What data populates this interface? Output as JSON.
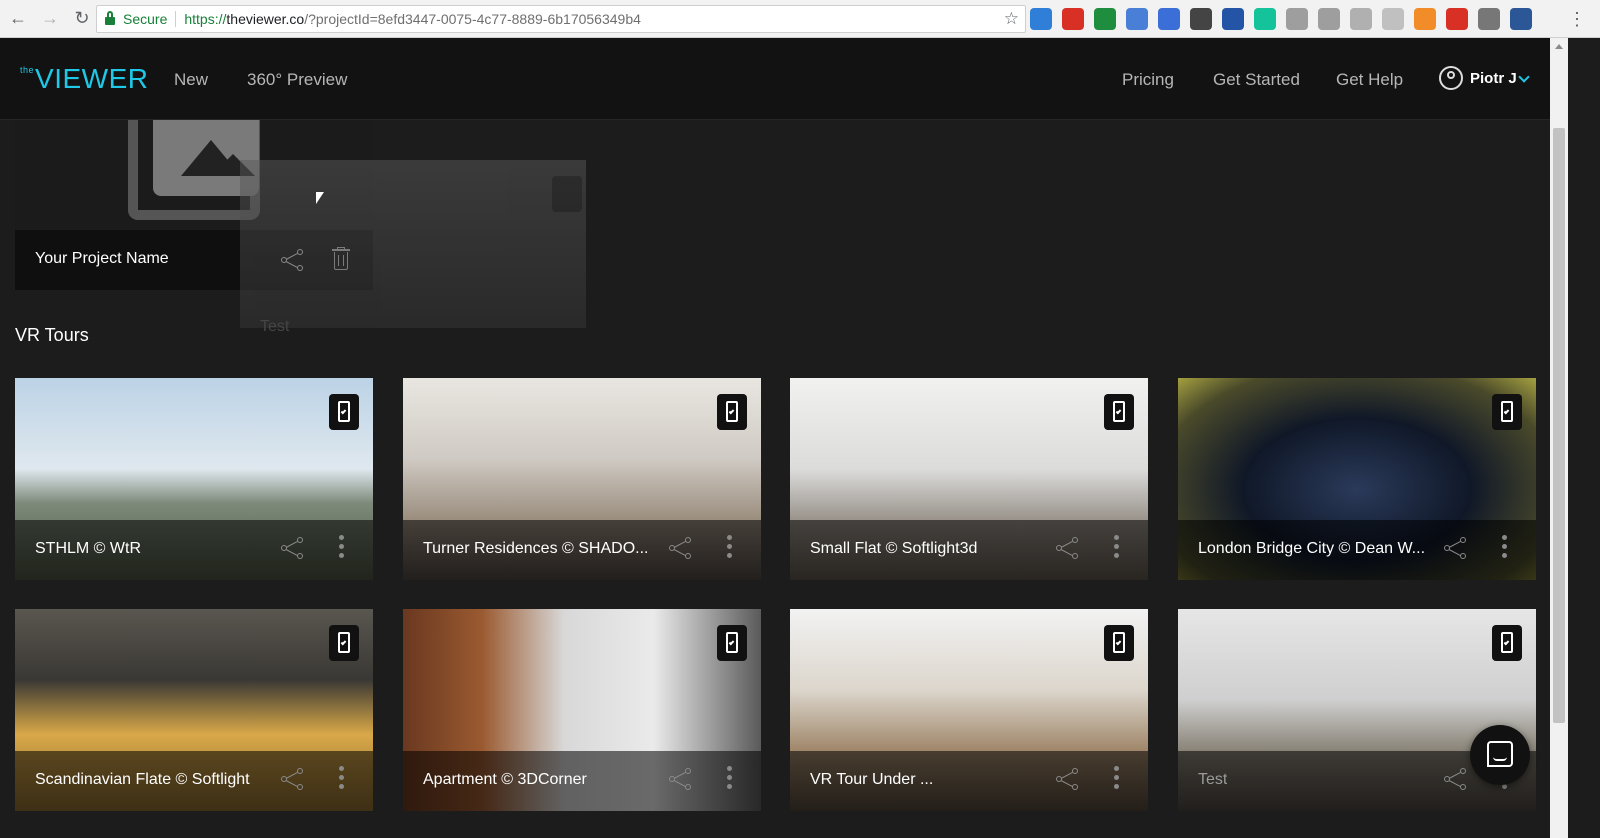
{
  "browser": {
    "secure_label": "Secure",
    "url_protocol": "https://",
    "url_host": "theviewer.co",
    "url_path": "/?projectId=8efd3447-0075-4c77-8889-6b17056349b4",
    "extensions": [
      {
        "icon": "shield-extension-icon",
        "color": "#2f7fd8"
      },
      {
        "icon": "circle-red-extension-icon",
        "color": "#d93025"
      },
      {
        "icon": "green-dot-extension-icon",
        "color": "#1e8e3e"
      },
      {
        "icon": "blue-box-extension-icon",
        "color": "#4a7fd8"
      },
      {
        "icon": "code-extension-icon",
        "color": "#3b6ed6"
      },
      {
        "icon": "pin-extension-icon",
        "color": "#444444"
      },
      {
        "icon": "new-extension-icon",
        "color": "#2454a6"
      },
      {
        "icon": "grammarly-extension-icon",
        "color": "#15c39a"
      },
      {
        "icon": "camera-extension-icon",
        "color": "#9e9e9e"
      },
      {
        "icon": "drive-extension-icon",
        "color": "#9e9e9e"
      },
      {
        "icon": "save-extension-icon",
        "color": "#b0b0b0"
      },
      {
        "icon": "grid-extension-icon",
        "color": "#c0c0c0"
      },
      {
        "icon": "off-extension-icon",
        "color": "#f28c28"
      },
      {
        "icon": "gear-red-extension-icon",
        "color": "#d93025"
      },
      {
        "icon": "window-extension-icon",
        "color": "#777777"
      },
      {
        "icon": "word-extension-icon",
        "color": "#2b5797"
      }
    ]
  },
  "header": {
    "logo_prefix": "the",
    "logo_main": "VIEWER",
    "nav_left": [
      "New",
      "360° Preview"
    ],
    "nav_right": [
      "Pricing",
      "Get Started",
      "Get Help"
    ],
    "user_name": "Piotr J",
    "accent_color": "#1ec8e6"
  },
  "draft_project": {
    "title": "Your Project Name",
    "ghost_title": "Test"
  },
  "section_title": "VR Tours",
  "tours": [
    {
      "title": "STHLM © WtR",
      "dim": false
    },
    {
      "title": "Turner Residences © SHADO...",
      "dim": false
    },
    {
      "title": "Small Flat © Softlight3d",
      "dim": false
    },
    {
      "title": "London Bridge City © Dean W...",
      "dim": false
    },
    {
      "title": "Scandinavian Flate © Softlight",
      "dim": false
    },
    {
      "title": "Apartment © 3DCorner",
      "dim": false
    },
    {
      "title": "VR Tour Under ...",
      "dim": false
    },
    {
      "title": "Test",
      "dim": true
    }
  ]
}
